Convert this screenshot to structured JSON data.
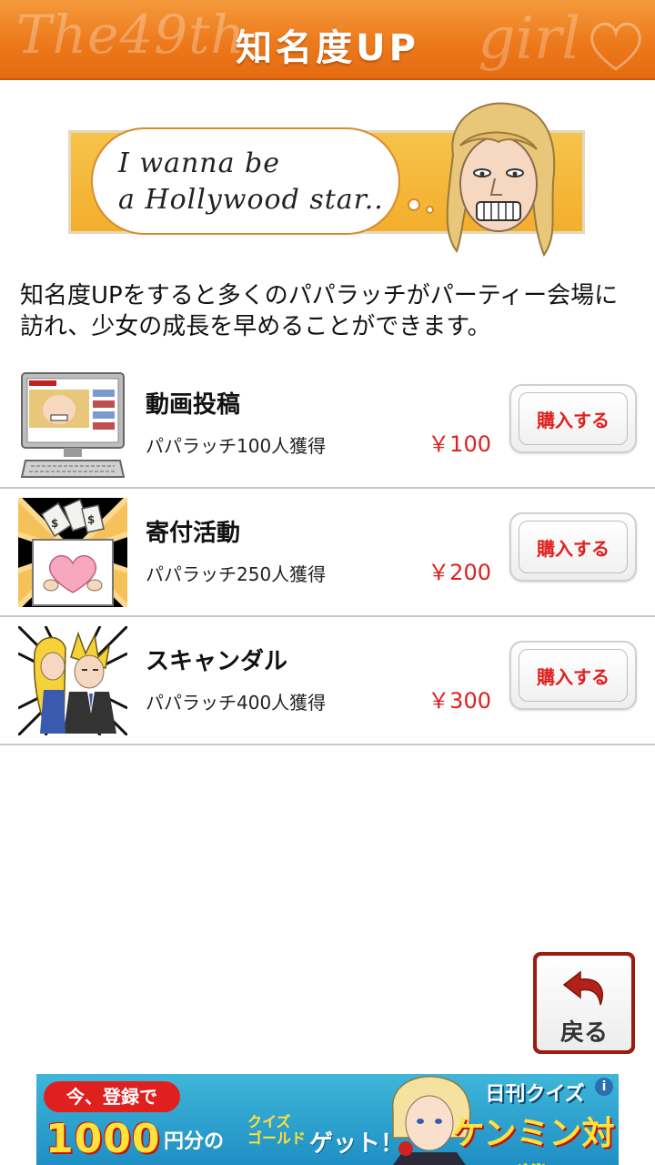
{
  "header": {
    "title": "知名度UP",
    "deco_left": "The49th",
    "deco_right": "girl"
  },
  "banner": {
    "line1": "I wanna be",
    "line2": "a Hollywood star.."
  },
  "description": "知名度UPをすると多くのパパラッチがパーティー会場に訪れ、少女の成長を早めることができます。",
  "items": [
    {
      "name": "動画投稿",
      "gain": "パパラッチ100人獲得",
      "price": "￥100",
      "buy_label": "購入する",
      "icon": "computer-video-icon"
    },
    {
      "name": "寄付活動",
      "gain": "パパラッチ250人獲得",
      "price": "￥200",
      "buy_label": "購入する",
      "icon": "donation-box-icon"
    },
    {
      "name": "スキャンダル",
      "gain": "パパラッチ400人獲得",
      "price": "￥300",
      "buy_label": "購入する",
      "icon": "scandal-couple-icon"
    }
  ],
  "back": {
    "label": "戻る"
  },
  "ad": {
    "pill": "今、登録で",
    "amount": "1000",
    "yen": "円分の",
    "quiz_gold_1": "クイズ",
    "quiz_gold_2": "ゴールド",
    "get": "ゲット！",
    "brand": "日刊クイズ",
    "battle": "ケンミン対戦",
    "info": "i"
  },
  "colors": {
    "header_orange": "#ec7a1c",
    "price_red": "#e0201f",
    "back_frame": "#9c1c10",
    "ad_blue": "#1f8fc4"
  }
}
